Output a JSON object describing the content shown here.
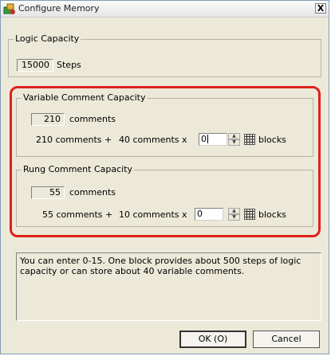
{
  "window": {
    "title": "Configure Memory",
    "close_label": "X"
  },
  "logic": {
    "title": "Logic Capacity",
    "value": "15000",
    "unit": "Steps"
  },
  "variable": {
    "title": "Variable Comment Capacity",
    "value": "210",
    "unit": "comments",
    "base": "210 comments +",
    "per_block": "40 comments x",
    "input_value": "0",
    "blocks_label": "blocks"
  },
  "rung": {
    "title": "Rung Comment Capacity",
    "value": "55",
    "unit": "comments",
    "base": "55 comments +",
    "per_block": "10 comments x",
    "input_value": "0",
    "blocks_label": "blocks"
  },
  "info": {
    "text": "You can enter 0-15. One block provides about 500 steps of logic capacity or can store about 40 variable comments."
  },
  "buttons": {
    "ok": "OK (O)",
    "cancel": "Cancel"
  },
  "icons": {
    "app": "configure-memory-app-icon",
    "grid": "grid-icon",
    "spin": "spin-arrows-icon"
  },
  "colors": {
    "highlight": "#e0201c",
    "dialog_bg": "#ece9d8"
  }
}
